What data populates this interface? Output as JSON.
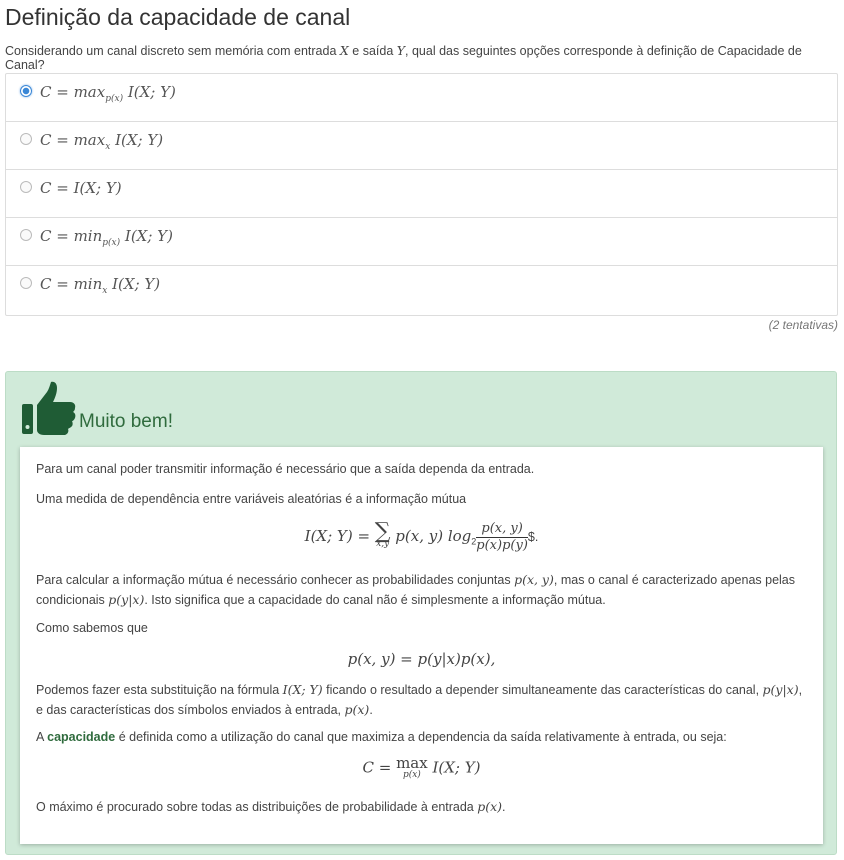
{
  "page": {
    "title": "Definição da capacidade de canal",
    "question_prefix": "Considerando um canal discreto sem memória com entrada ",
    "question_x": "X",
    "question_mid": " e saída ",
    "question_y": "Y",
    "question_suffix": ", qual das seguintes opções corresponde à definição de Capacidade de Canal?"
  },
  "options": [
    {
      "main": "C = max",
      "sub": "p(x)",
      "rest": " I(X; Y)",
      "checked": true
    },
    {
      "main": "C = max",
      "sub": "x",
      "rest": " I(X; Y)",
      "checked": false
    },
    {
      "main": "C = I(X; Y)",
      "sub": "",
      "rest": "",
      "checked": false
    },
    {
      "main": "C = min",
      "sub": "p(x)",
      "rest": " I(X; Y)",
      "checked": false
    },
    {
      "main": "C = min",
      "sub": "x",
      "rest": " I(X; Y)",
      "checked": false
    }
  ],
  "attempts": "(2 tentativas)",
  "feedback": {
    "icon": "thumbs-up-icon",
    "verdict": "Muito bem!",
    "p1": "Para um canal poder transmitir informação é necessário que a saída dependa da entrada.",
    "p2": "Uma medida de dependência entre variáveis aleatórias é a informação mútua",
    "eq1_lhs": "I(X; Y) = ",
    "eq1_sum_sub": "x,y",
    "eq1_mid": " p(x, y) log",
    "eq1_log_sub": "2",
    "eq1_num": "p(x, y)",
    "eq1_den": "p(x)p(y)",
    "eq1_tail": "$.",
    "p3_a": "Para calcular a informação mútua é necessário conhecer as probabilidades conjuntas ",
    "p3_m1": "p(x, y)",
    "p3_b": ", mas o canal é caracterizado apenas pelas condicionais ",
    "p3_m2": "p(y|x)",
    "p3_c": ". Isto significa que a capacidade do canal não é simplesmente a informação mútua.",
    "p4": "Como sabemos que",
    "eq2": "p(x, y) = p(y|x)p(x),",
    "p5_a": "Podemos fazer esta substituição na fórmula ",
    "p5_m1": "I(X; Y)",
    "p5_b": " ficando o resultado a depender simultaneamente das características do canal, ",
    "p5_m2": "p(y|x)",
    "p5_c": ", e das características dos símbolos enviados à entrada, ",
    "p5_m3": "p(x)",
    "p5_d": ".",
    "p6_a": "A ",
    "p6_strong": "capacidade",
    "p6_b": " é definida como a utilização do canal que maximiza a dependencia da saída relativamente à entrada, ou seja:",
    "eq3_lhs": "C = ",
    "eq3_op": "max",
    "eq3_sub": "p(x)",
    "eq3_rest": " I(X; Y)",
    "p7_a": "O máximo é procurado sobre todas as distribuições de probabilidade à entrada ",
    "p7_m": "p(x)",
    "p7_b": "."
  },
  "colors": {
    "accent": "#3a87d6",
    "success_bg": "#d0ead9",
    "success_text": "#2f6b3d",
    "thumb": "#1f5c35"
  }
}
